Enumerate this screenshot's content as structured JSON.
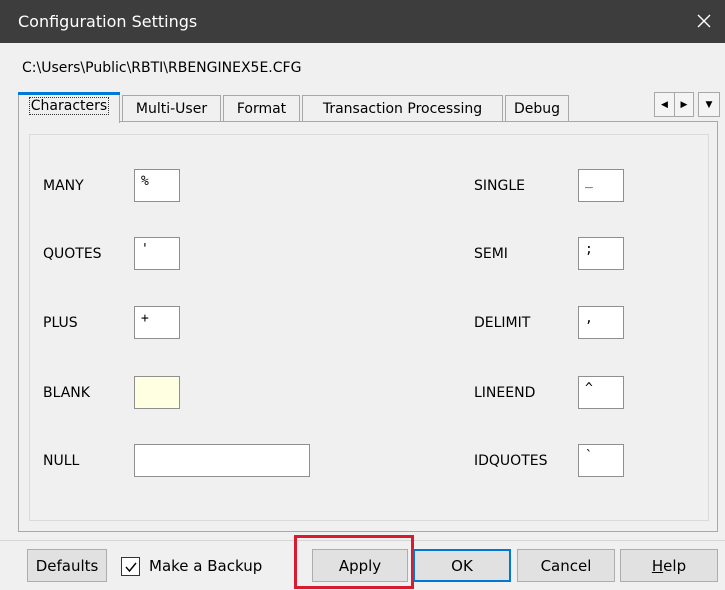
{
  "window": {
    "title": "Configuration Settings",
    "close_icon": "close-icon"
  },
  "path": "C:\\Users\\Public\\RBTI\\RBENGINEX5E.CFG",
  "tabs": [
    {
      "label": "Characters",
      "active": true
    },
    {
      "label": "Multi-User",
      "active": false
    },
    {
      "label": "Format",
      "active": false
    },
    {
      "label": "Transaction Processing",
      "active": false
    },
    {
      "label": "Debug",
      "active": false
    }
  ],
  "tab_controls": {
    "scroll_left": "◀",
    "scroll_right": "▶",
    "dropdown": "▼"
  },
  "fields_left": [
    {
      "label": "MANY",
      "value": "%"
    },
    {
      "label": "QUOTES",
      "value": "'"
    },
    {
      "label": "PLUS",
      "value": "+"
    },
    {
      "label": "BLANK",
      "value": ""
    },
    {
      "label": "NULL",
      "value": ""
    }
  ],
  "fields_right": [
    {
      "label": "SINGLE",
      "value": "_"
    },
    {
      "label": "SEMI",
      "value": ";"
    },
    {
      "label": "DELIMIT",
      "value": ","
    },
    {
      "label": "LINEEND",
      "value": "^"
    },
    {
      "label": "IDQUOTES",
      "value": "`"
    }
  ],
  "buttons": {
    "defaults": "Defaults",
    "make_backup": "Make a Backup",
    "make_backup_checked": true,
    "apply": "Apply",
    "ok": "OK",
    "cancel": "Cancel",
    "help_prefix": "H",
    "help_rest": "elp"
  },
  "colors": {
    "titlebar": "#3d3d3d",
    "accent": "#0078d7",
    "highlight": "#d81b2f",
    "blank_field": "#ffffe1"
  }
}
